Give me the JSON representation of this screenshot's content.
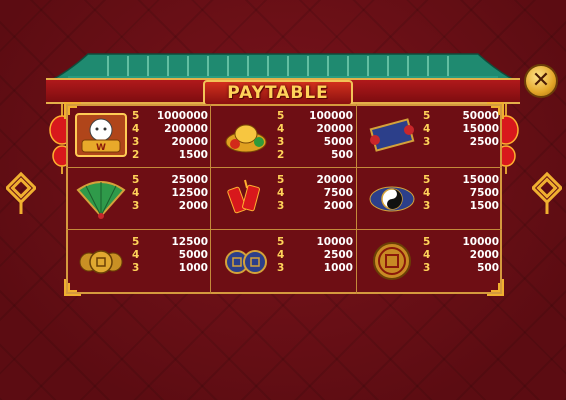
{
  "title": "PAYTABLE",
  "close_icon": "close-x-icon",
  "colors": {
    "background": "#6a0f16",
    "panel": "#6e0e14",
    "gold": "#ffd35a",
    "roof_green": "#1f8a70",
    "border": "#d59a3e"
  },
  "symbols": [
    {
      "icon": "wild-lucky-cat-icon",
      "pays": [
        {
          "count": "5",
          "value": "1000000"
        },
        {
          "count": "4",
          "value": "200000"
        },
        {
          "count": "3",
          "value": "20000"
        },
        {
          "count": "2",
          "value": "1500"
        }
      ]
    },
    {
      "icon": "gold-ingot-icon",
      "pays": [
        {
          "count": "5",
          "value": "100000"
        },
        {
          "count": "4",
          "value": "20000"
        },
        {
          "count": "3",
          "value": "5000"
        },
        {
          "count": "2",
          "value": "500"
        }
      ]
    },
    {
      "icon": "scroll-icon",
      "pays": [
        {
          "count": "5",
          "value": "50000"
        },
        {
          "count": "4",
          "value": "15000"
        },
        {
          "count": "3",
          "value": "2500"
        }
      ]
    },
    {
      "icon": "folding-fan-icon",
      "pays": [
        {
          "count": "5",
          "value": "25000"
        },
        {
          "count": "4",
          "value": "12500"
        },
        {
          "count": "3",
          "value": "2000"
        }
      ]
    },
    {
      "icon": "firecracker-icon",
      "pays": [
        {
          "count": "5",
          "value": "20000"
        },
        {
          "count": "4",
          "value": "7500"
        },
        {
          "count": "3",
          "value": "2000"
        }
      ]
    },
    {
      "icon": "yin-yang-icon",
      "pays": [
        {
          "count": "5",
          "value": "15000"
        },
        {
          "count": "4",
          "value": "7500"
        },
        {
          "count": "3",
          "value": "1500"
        }
      ]
    },
    {
      "icon": "gold-coins-icon",
      "pays": [
        {
          "count": "5",
          "value": "12500"
        },
        {
          "count": "4",
          "value": "5000"
        },
        {
          "count": "3",
          "value": "1000"
        }
      ]
    },
    {
      "icon": "blue-coins-icon",
      "pays": [
        {
          "count": "5",
          "value": "10000"
        },
        {
          "count": "4",
          "value": "2500"
        },
        {
          "count": "3",
          "value": "1000"
        }
      ]
    },
    {
      "icon": "gold-medallion-icon",
      "pays": [
        {
          "count": "5",
          "value": "10000"
        },
        {
          "count": "4",
          "value": "2000"
        },
        {
          "count": "3",
          "value": "500"
        }
      ]
    }
  ]
}
